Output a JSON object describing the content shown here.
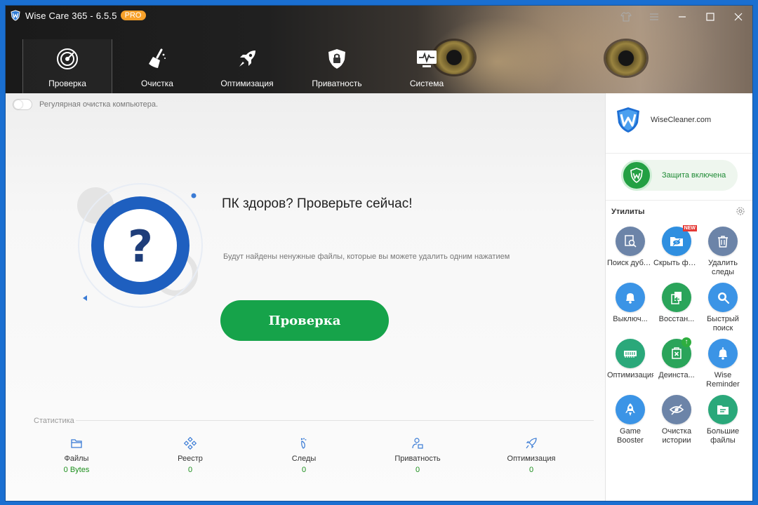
{
  "titlebar": {
    "title": "Wise Care 365 - 6.5.5",
    "badge": "PRO"
  },
  "nav": [
    {
      "label": "Проверка",
      "icon": "radar-icon"
    },
    {
      "label": "Очистка",
      "icon": "broom-icon"
    },
    {
      "label": "Оптимизация",
      "icon": "rocket-icon"
    },
    {
      "label": "Приватность",
      "icon": "shield-lock-icon"
    },
    {
      "label": "Система",
      "icon": "monitor-pulse-icon"
    }
  ],
  "main": {
    "auto_clean_label": "Регулярная очистка компьютера.",
    "headline": "ПК здоров? Проверьте сейчас!",
    "subline": "Будут найдены ненужные файлы, которые вы можете удалить одним нажатием",
    "scan_button": "Проверка"
  },
  "stats": {
    "title": "Статистика",
    "items": [
      {
        "label": "Файлы",
        "value": "0 Bytes"
      },
      {
        "label": "Реестр",
        "value": "0"
      },
      {
        "label": "Следы",
        "value": "0"
      },
      {
        "label": "Приватность",
        "value": "0"
      },
      {
        "label": "Оптимизация",
        "value": "0"
      }
    ]
  },
  "side": {
    "brand": "WiseCleaner.com",
    "protection": "Защита включена",
    "utilities_title": "Утилиты",
    "utilities": [
      {
        "label": "Поиск дубликатов",
        "display": "Поиск дублика...",
        "color": "#6c84a8"
      },
      {
        "label": "Скрыть файл/папку",
        "display": "Скрыть файл/па...",
        "color": "#2f8fe0",
        "badge": "NEW"
      },
      {
        "label": "Удалить следы",
        "display": "Удалить следы",
        "color": "#6c84a8"
      },
      {
        "label": "Выключение",
        "display": "Выключ...",
        "color": "#3b94e6"
      },
      {
        "label": "Восстановление",
        "display": "Восстан...",
        "color": "#2aa45a"
      },
      {
        "label": "Быстрый поиск",
        "display": "Быстрый поиск",
        "color": "#3b94e6"
      },
      {
        "label": "Оптимизация памяти",
        "display": "Оптимизация памяти",
        "color": "#2aa87a"
      },
      {
        "label": "Деинсталлятор",
        "display": "Деинста...",
        "color": "#2aa45a"
      },
      {
        "label": "Wise Reminder",
        "display": "Wise Reminder",
        "color": "#3b94e6"
      },
      {
        "label": "Game Booster",
        "display": "Game Booster",
        "color": "#3b94e6"
      },
      {
        "label": "Очистка истории",
        "display": "Очистка истории",
        "color": "#6c84a8"
      },
      {
        "label": "Большие файлы",
        "display": "Большие файлы",
        "color": "#2aa87a"
      }
    ]
  }
}
